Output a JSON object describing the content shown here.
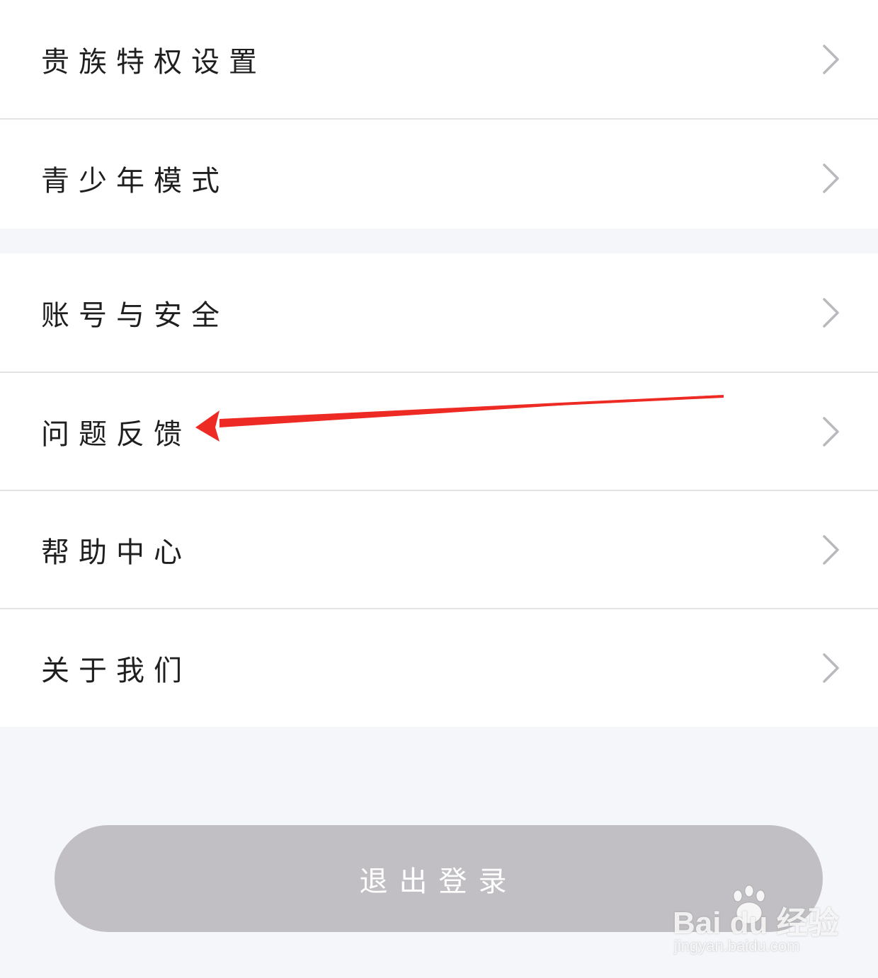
{
  "settings_group_1": [
    {
      "label": "贵族特权设置"
    },
    {
      "label": "青少年模式"
    }
  ],
  "settings_group_2": [
    {
      "label": "账号与安全"
    },
    {
      "label": "问题反馈"
    },
    {
      "label": "帮助中心"
    },
    {
      "label": "关于我们"
    }
  ],
  "logout_button": {
    "label": "退出登录"
  },
  "annotation": {
    "type": "red-arrow",
    "points_to": "问题反馈",
    "color": "#ee2a24"
  },
  "watermark": {
    "main": "Bai du 经验",
    "sub": "jingyan.baidu.com"
  },
  "icons": {
    "row_chevron": "chevron-right-icon"
  },
  "colors": {
    "page_background": "#f5f6fa",
    "row_background": "#ffffff",
    "divider": "#e3e3e6",
    "text": "#1f1f1f",
    "chevron": "#b9b9bd",
    "logout_background": "#c1bfc3",
    "logout_text": "#ffffff"
  }
}
